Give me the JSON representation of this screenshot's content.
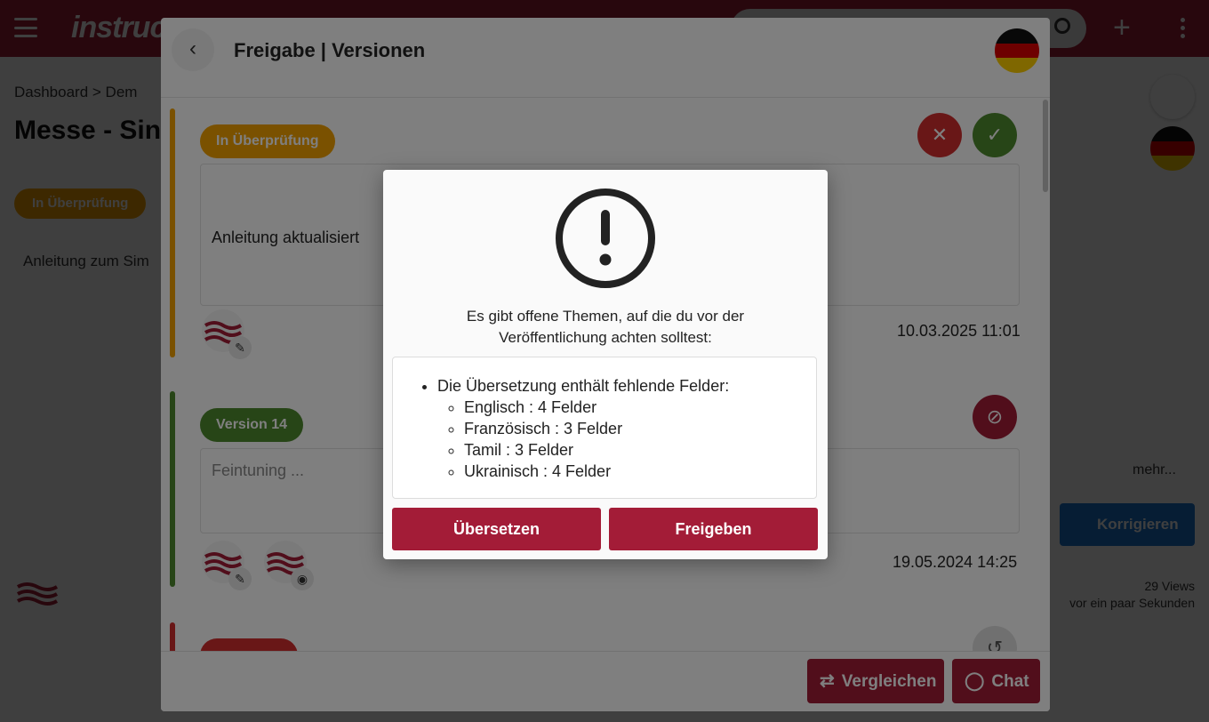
{
  "app": {
    "logo_text": "instruc",
    "breadcrumb": "Dashboard  >  Dem",
    "page_title": "Messe - Sin",
    "status": "In Überprüfung",
    "description": "Anleitung zum Sim",
    "more_link": "mehr...",
    "correct_button": "Korrigieren",
    "views": "29 Views",
    "updated": "vor ein paar Sekunden"
  },
  "panel": {
    "title": "Freigabe | Versionen",
    "entries": [
      {
        "badge": "In Überprüfung",
        "badge_color": "#f4a300",
        "comment": "Anleitung aktualisiert",
        "timestamp": "10.03.2025 11:01"
      },
      {
        "badge": "Version 14",
        "badge_color": "#4e8a2e",
        "comment_placeholder": "Feintuning ...",
        "timestamp": "19.05.2024 14:25"
      }
    ],
    "compare_button": "Vergleichen",
    "chat_button": "Chat"
  },
  "dialog": {
    "message": "Es gibt offene Themen, auf die du vor der Veröffentlichung achten solltest:",
    "issue_title": "Die Übersetzung enthält fehlende Felder:",
    "issues": [
      "Englisch : 4 Felder",
      "Französisch : 3 Felder",
      "Tamil : 3 Felder",
      "Ukrainisch : 4 Felder"
    ],
    "translate_button": "Übersetzen",
    "approve_button": "Freigeben"
  },
  "colors": {
    "brand": "#a31c37",
    "review": "#f4a300",
    "version": "#4e8a2e",
    "reject": "#d32f2f",
    "approve": "#4e8a2e"
  }
}
